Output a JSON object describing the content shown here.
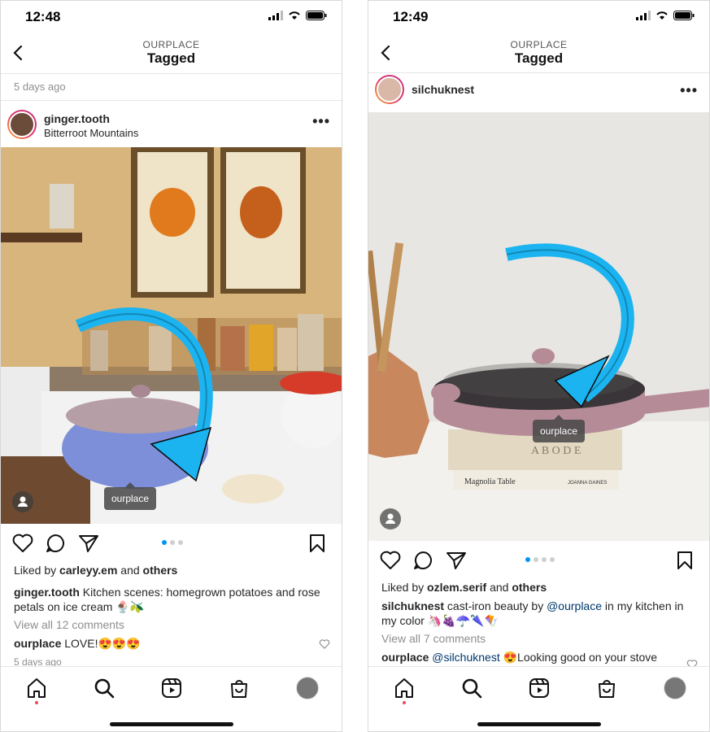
{
  "left": {
    "status_time": "12:48",
    "header_overline": "OURPLACE",
    "header_title": "Tagged",
    "prev_timestamp": "5 days ago",
    "post": {
      "username": "ginger.tooth",
      "location": "Bitterroot Mountains",
      "tag_label": "ourplace",
      "liked_prefix": "Liked by ",
      "liked_user": "carleyy.em",
      "liked_and": " and ",
      "liked_others": "others",
      "caption_user": "ginger.tooth",
      "caption_text": " Kitchen scenes: homegrown potatoes and rose petals on ice cream 🍨🫒",
      "view_comments": "View all 12 comments",
      "comment_user": "ourplace",
      "comment_text": " LOVE!😍😍😍",
      "timestamp": "5 days ago"
    }
  },
  "right": {
    "status_time": "12:49",
    "header_overline": "OURPLACE",
    "header_title": "Tagged",
    "post": {
      "username": "silchuknest",
      "tag_label": "ourplace",
      "book_top": "A B O D E",
      "book_bottom": "Magnolia Table",
      "book_bottom_author": "JOANNA GAINES",
      "liked_prefix": "Liked by ",
      "liked_user": "ozlem.serif",
      "liked_and": " and ",
      "liked_others": "others",
      "caption_user": "silchuknest",
      "caption_text_1": " cast-iron beauty by ",
      "caption_mention": "@ourplace",
      "caption_text_2": " in my kitchen in my color 🦄🍇☂️🌂🪁",
      "view_comments": "View all 7 comments",
      "comment_user": "ourplace",
      "comment_mention": " @silchuknest",
      "comment_text": " 😍Looking good on your stove"
    }
  },
  "colors": {
    "accent_blue": "#0095f6",
    "arrow_blue": "#1bb4f0",
    "notification_red": "#ed4956"
  }
}
